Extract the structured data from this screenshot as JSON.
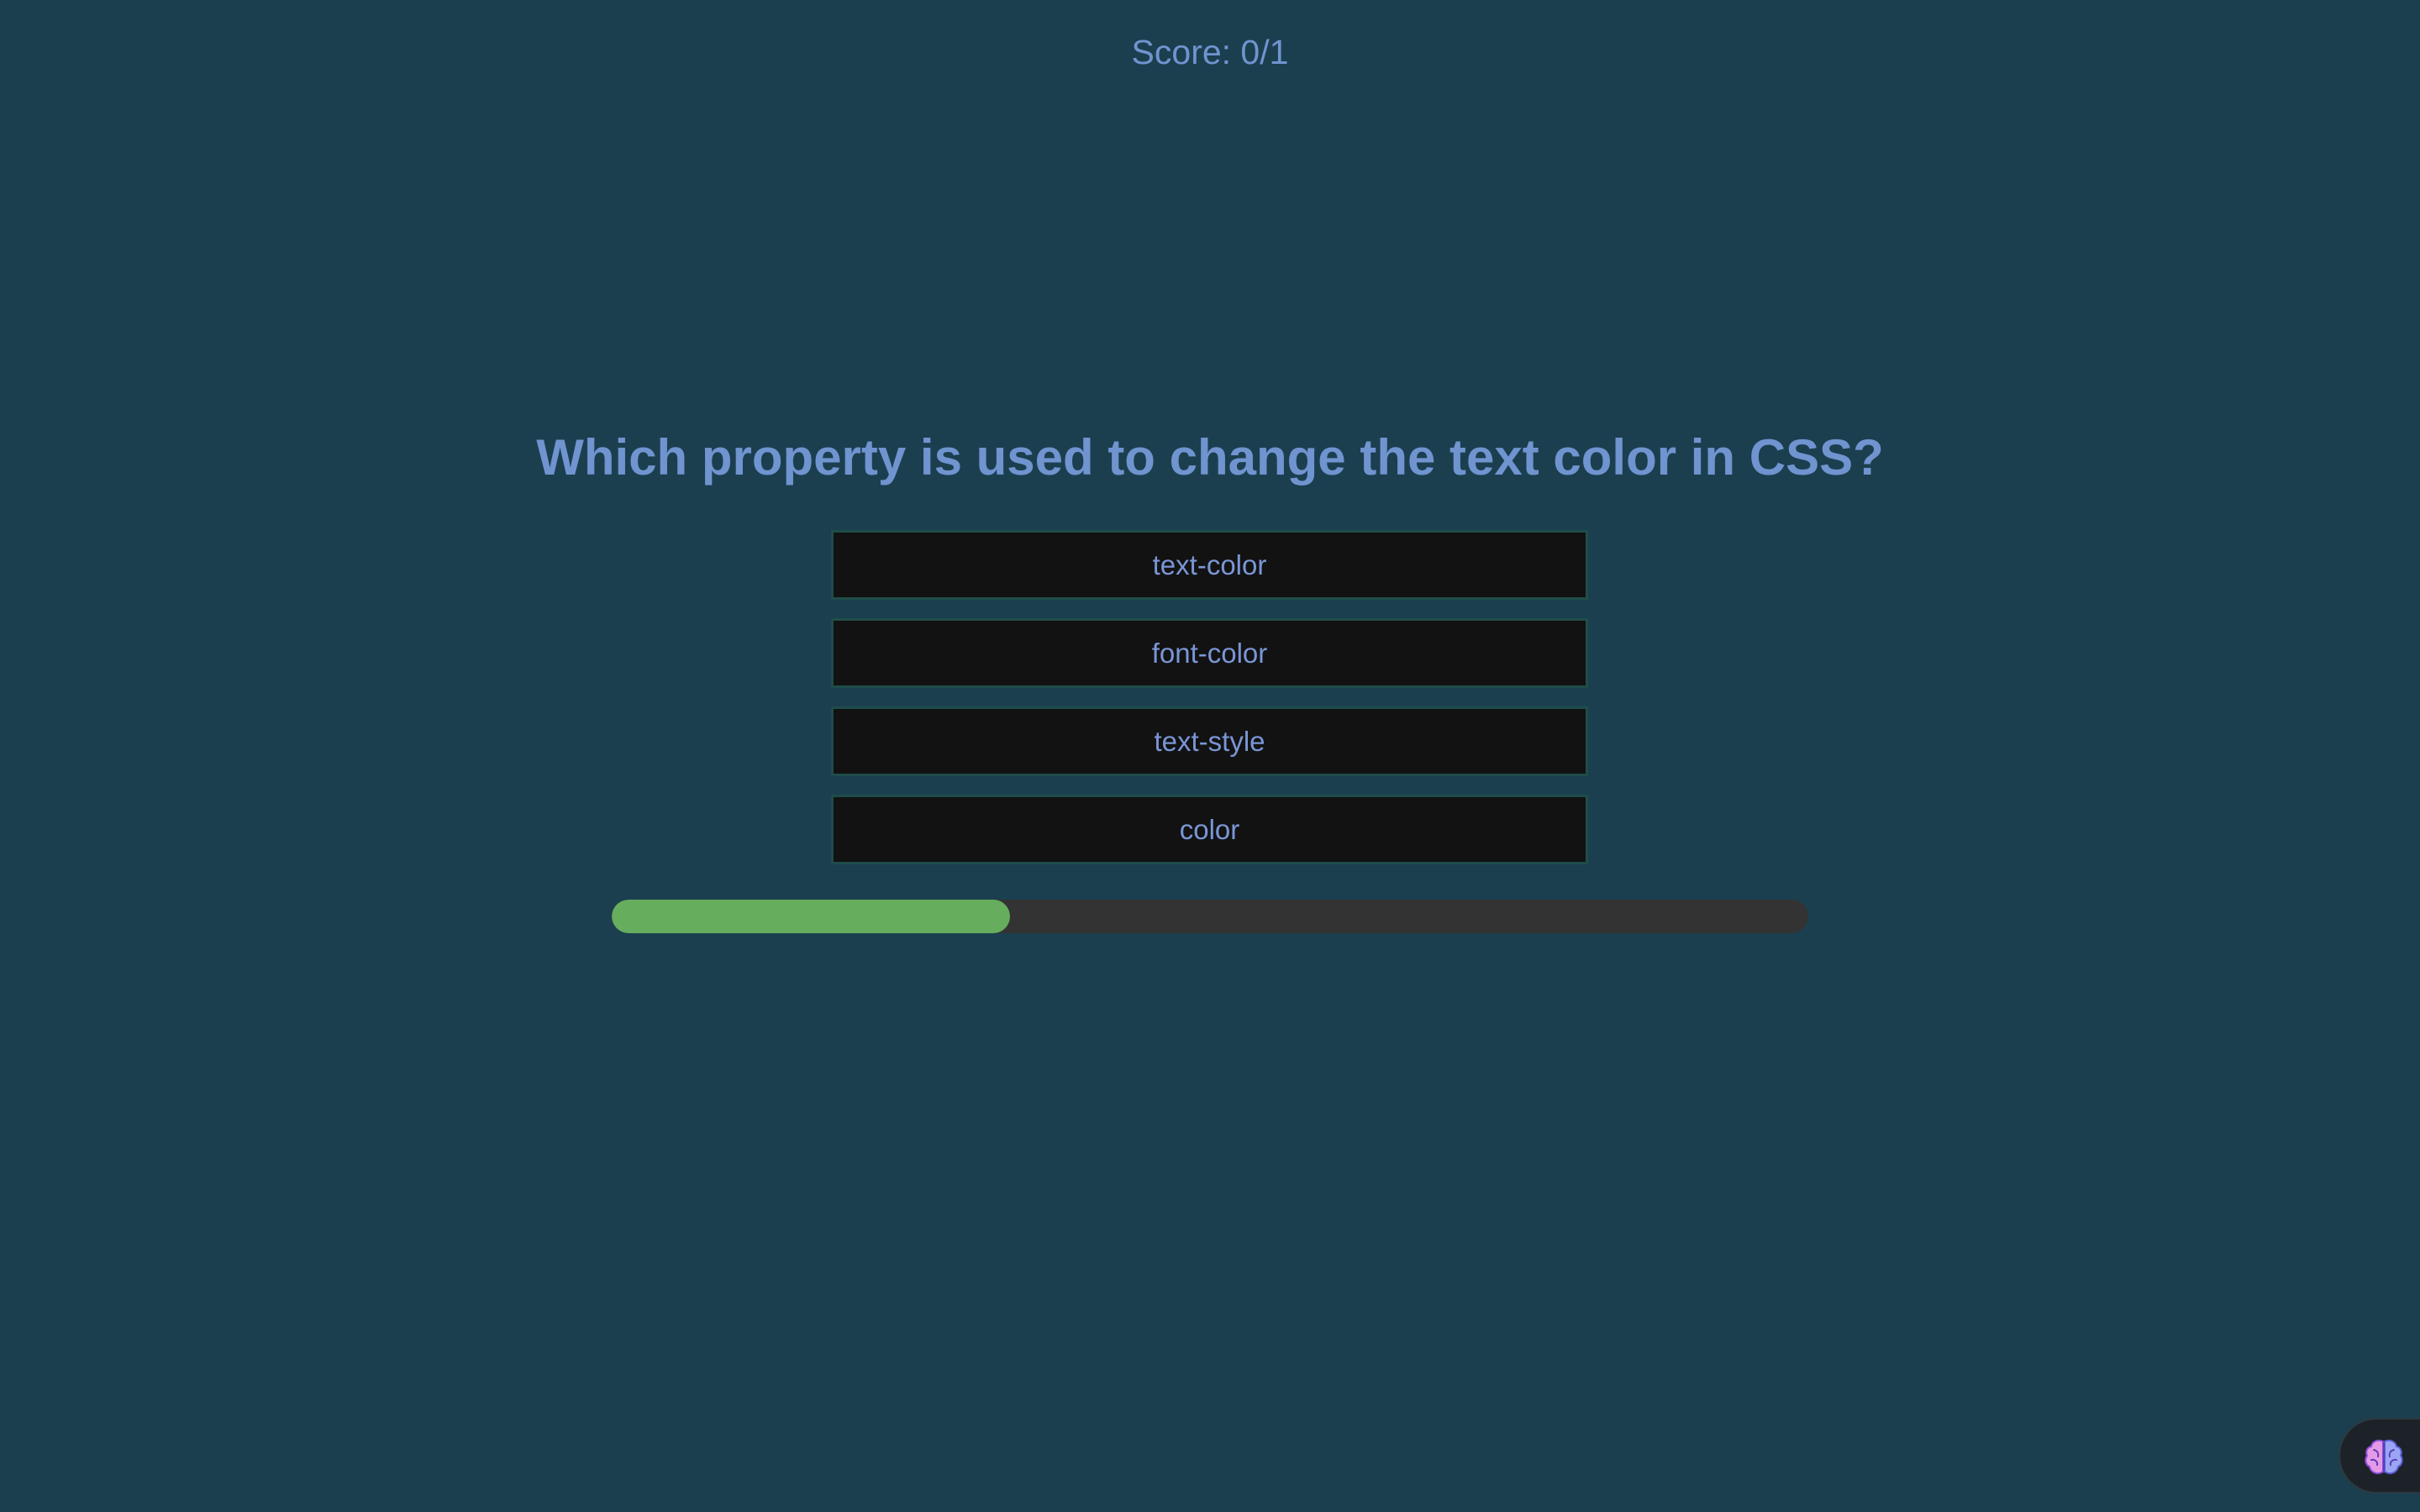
{
  "score": {
    "text": "Score: 0/1"
  },
  "question": {
    "text": "Which property is used to change the text color in CSS?"
  },
  "options": [
    {
      "label": "text-color"
    },
    {
      "label": "font-color"
    },
    {
      "label": "text-style"
    },
    {
      "label": "color"
    }
  ],
  "progress": {
    "fraction": 0.333
  },
  "assistant": {
    "icon": "brain-icon"
  },
  "colors": {
    "background": "#1b3f4f",
    "text_accent": "#7094cf",
    "option_background": "#121212",
    "option_border": "#1f4d4a",
    "progress_fill": "#66ad5e",
    "progress_track": "#333333"
  }
}
